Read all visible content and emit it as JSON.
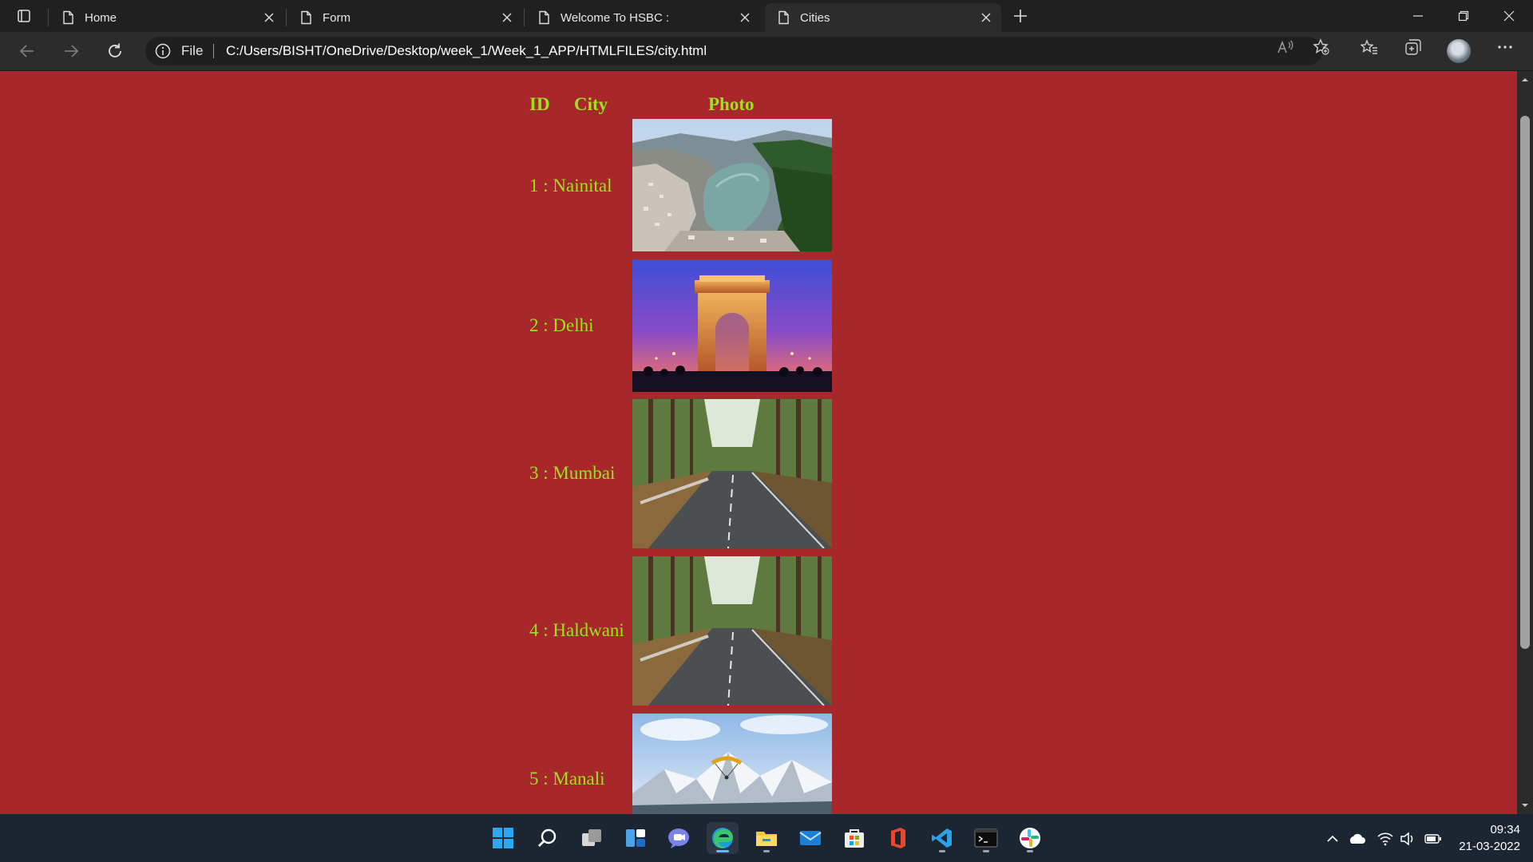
{
  "browser": {
    "tabs": [
      {
        "title": "Home",
        "active": false
      },
      {
        "title": "Form",
        "active": false
      },
      {
        "title": "Welcome To HSBC :",
        "active": false
      },
      {
        "title": "Cities",
        "active": true
      }
    ],
    "address": {
      "scheme_label": "File",
      "url": "C:/Users/BISHT/OneDrive/Desktop/week_1/Week_1_APP/HTMLFILES/city.html"
    }
  },
  "page": {
    "background_color": "#a8272a",
    "text_color": "#9be31d",
    "headers": {
      "id": "ID",
      "city": "City",
      "photo": "Photo"
    },
    "rows": [
      {
        "label": "1 : Nainital",
        "photo": "lake-valley-photo"
      },
      {
        "label": "2 : Delhi",
        "photo": "india-gate-photo"
      },
      {
        "label": "3 : Mumbai",
        "photo": "forest-road-photo"
      },
      {
        "label": "4 : Haldwani",
        "photo": "forest-road-photo"
      },
      {
        "label": "5 : Manali",
        "photo": "snow-mountain-paraglider-photo"
      }
    ]
  },
  "taskbar": {
    "apps": [
      "start-icon",
      "search-icon",
      "task-view-icon",
      "widgets-icon",
      "chat-icon",
      "edge-icon",
      "file-explorer-icon",
      "mail-icon",
      "store-icon",
      "office-icon",
      "vscode-icon",
      "terminal-icon",
      "slack-icon"
    ],
    "clock": {
      "time": "09:34",
      "date": "21-03-2022"
    }
  }
}
